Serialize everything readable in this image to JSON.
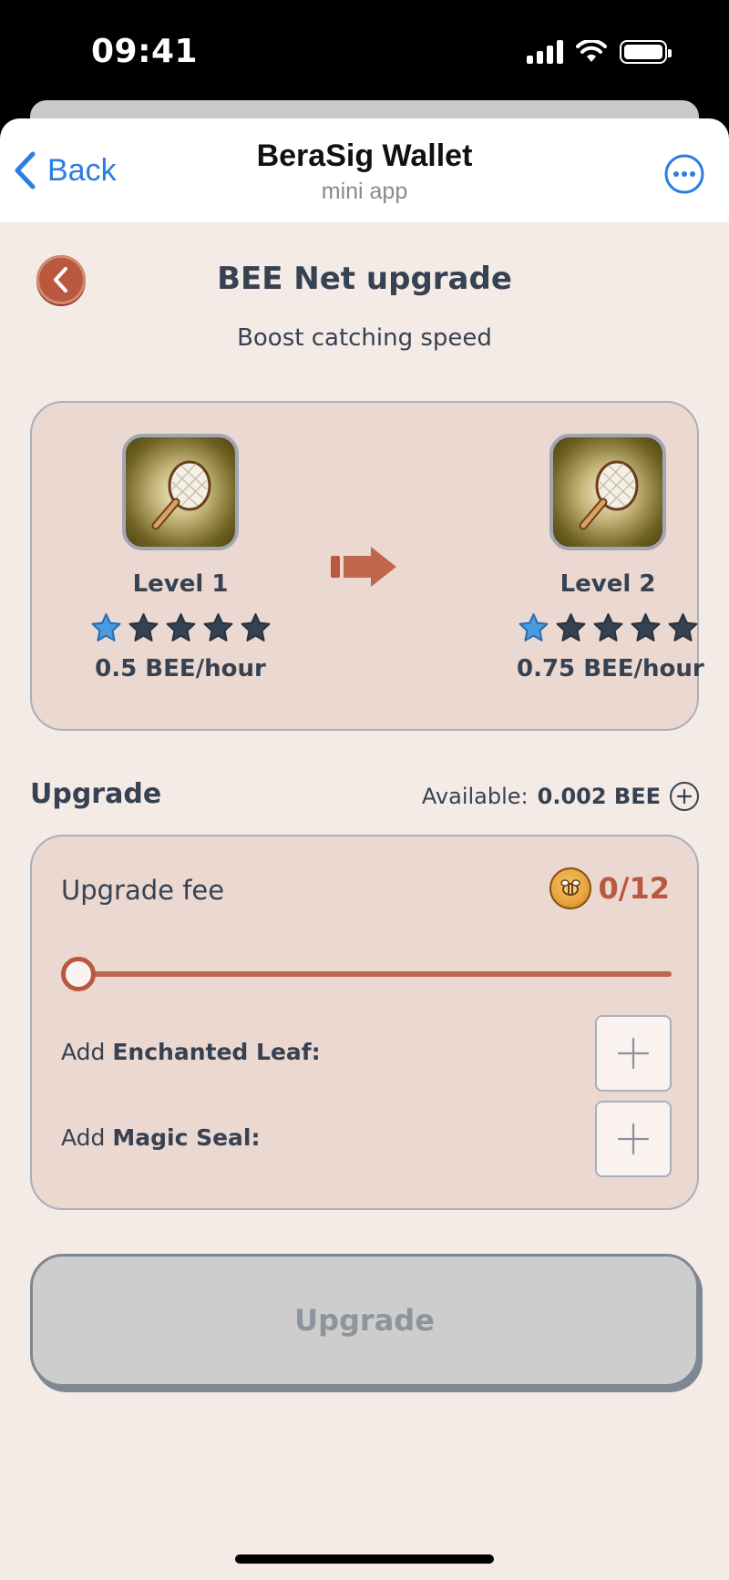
{
  "status_bar": {
    "time": "09:41"
  },
  "telegram": {
    "back_label": "Back",
    "title": "BeraSig Wallet",
    "subtitle": "mini app",
    "more_icon": "ellipsis-circle-icon"
  },
  "page": {
    "title": "BEE Net upgrade",
    "subtitle": "Boost catching speed"
  },
  "levels": {
    "current": {
      "name": "Level 1",
      "stars_filled": 1,
      "stars_total": 5,
      "rate": "0.5 BEE/hour"
    },
    "next": {
      "name": "Level 2",
      "stars_filled": 1,
      "stars_total": 5,
      "rate": "0.75 BEE/hour"
    }
  },
  "upgrade_section": {
    "title": "Upgrade",
    "available_label": "Available:",
    "available_value": "0.002 BEE"
  },
  "fee": {
    "label": "Upgrade fee",
    "count": "0/12",
    "progress": 0
  },
  "addons": {
    "leaf_prefix": "Add ",
    "leaf_name": "Enchanted Leaf:",
    "seal_prefix": "Add ",
    "seal_name": "Magic Seal:"
  },
  "button": {
    "label": "Upgrade",
    "enabled": false
  },
  "colors": {
    "accent": "#b9583f",
    "text": "#364152",
    "background": "#f4ebe6",
    "card": "#ebd8d1",
    "star_active": "#4a9be0",
    "star_inactive": "#364152",
    "link": "#2b7de1"
  }
}
